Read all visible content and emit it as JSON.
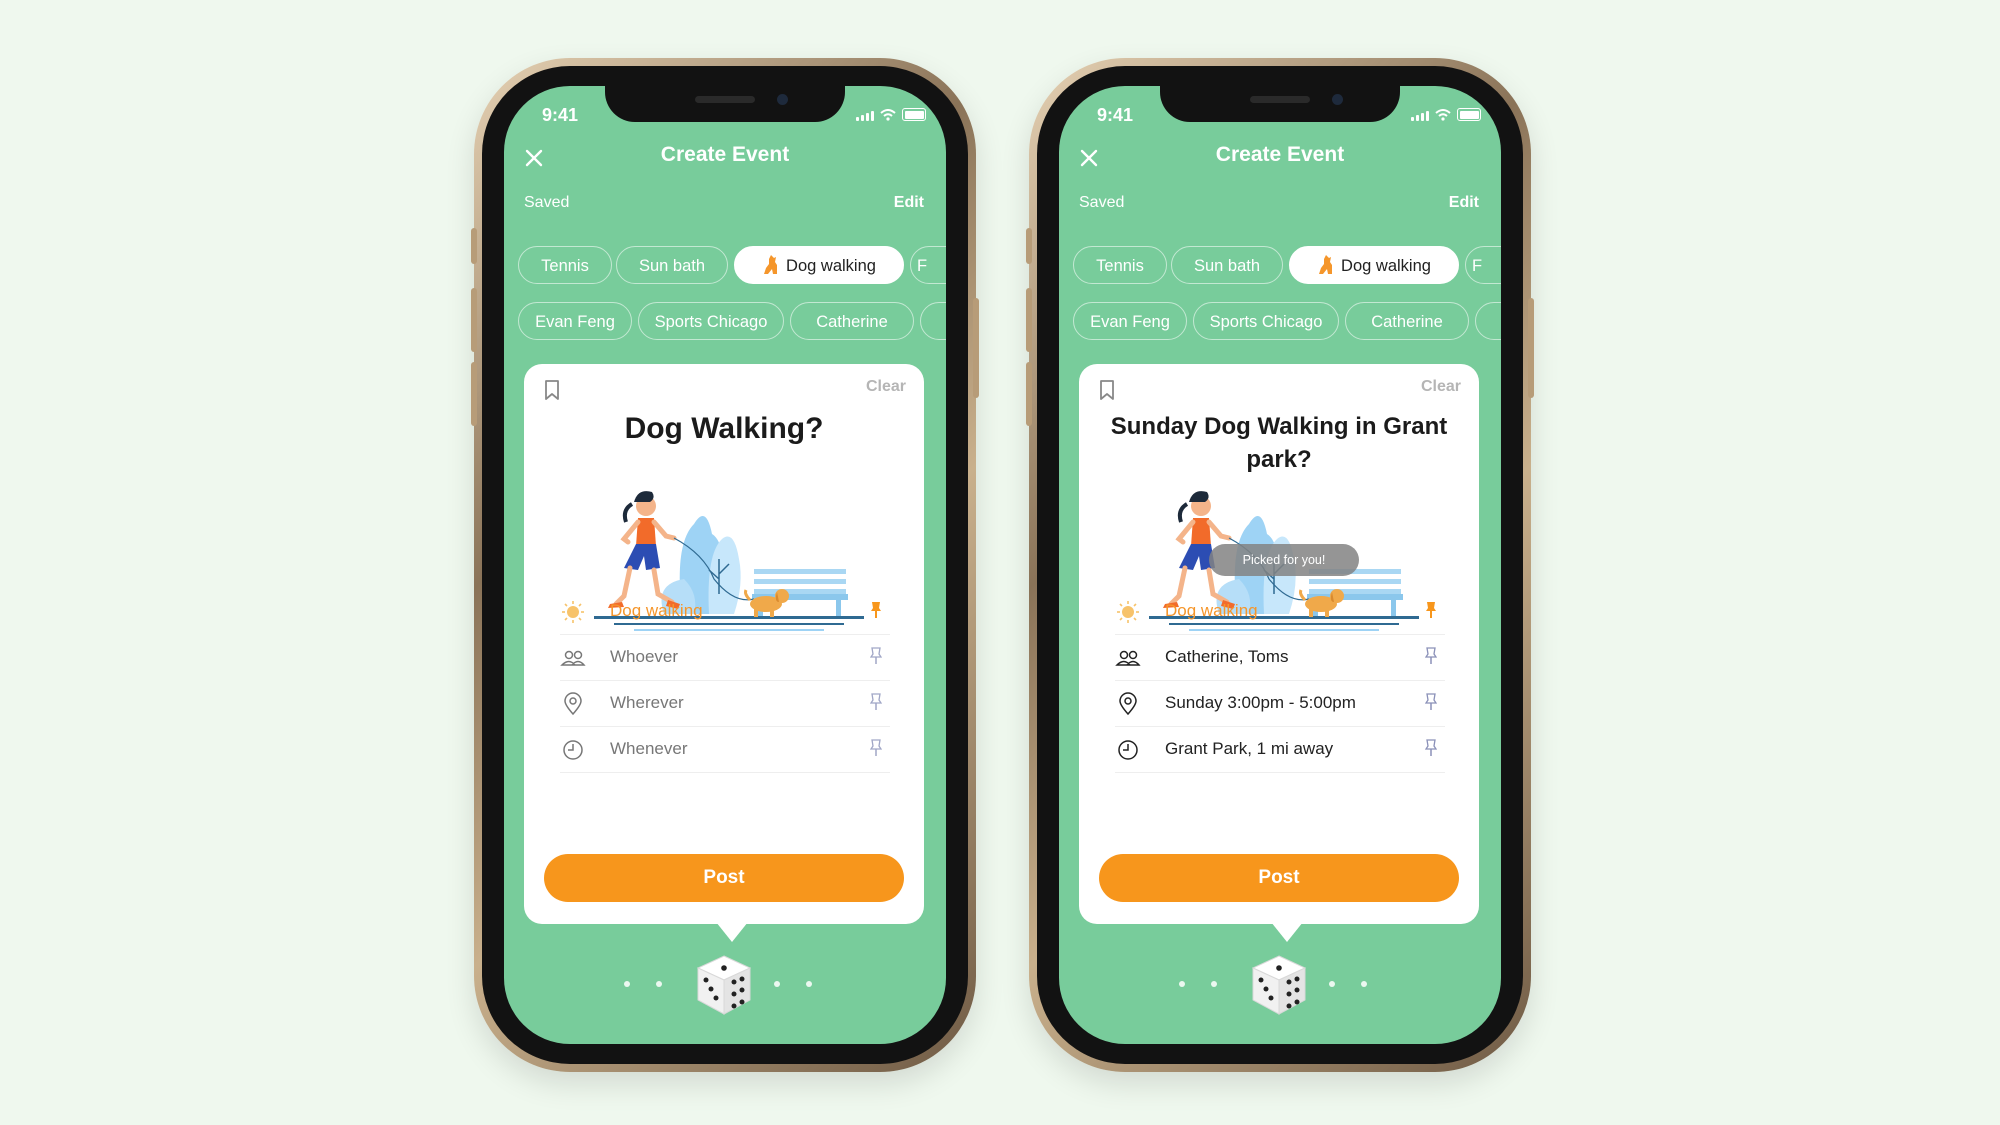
{
  "screens": [
    {
      "status_time": "9:41",
      "title": "Create Event",
      "saved_label": "Saved",
      "edit_label": "Edit",
      "chips_row1": [
        "Tennis",
        "Sun bath",
        "Dog walking",
        "F"
      ],
      "chips_row2": [
        "Evan Feng",
        "Sports Chicago",
        "Catherine",
        ""
      ],
      "active_chip": "Dog walking",
      "clear_label": "Clear",
      "card_title": "Dog Walking?",
      "tooltip": "",
      "rows": [
        {
          "icon": "sun-icon",
          "label": "Dog walking",
          "pinned": true
        },
        {
          "icon": "people-icon",
          "label": "Whoever",
          "pinned": false
        },
        {
          "icon": "location-pin-icon",
          "label": "Wherever",
          "pinned": false
        },
        {
          "icon": "clock-icon",
          "label": "Whenever",
          "pinned": false
        }
      ],
      "post_label": "Post"
    },
    {
      "status_time": "9:41",
      "title": "Create Event",
      "saved_label": "Saved",
      "edit_label": "Edit",
      "chips_row1": [
        "Tennis",
        "Sun bath",
        "Dog walking",
        "F"
      ],
      "chips_row2": [
        "Evan Feng",
        "Sports Chicago",
        "Catherine",
        ""
      ],
      "active_chip": "Dog walking",
      "clear_label": "Clear",
      "card_title": "Sunday Dog Walking in Grant park?",
      "tooltip": "Picked for you!",
      "rows": [
        {
          "icon": "sun-icon",
          "label": "Dog walking",
          "pinned": true
        },
        {
          "icon": "people-icon",
          "label": "Catherine, Toms",
          "pinned": false
        },
        {
          "icon": "location-pin-icon",
          "label": "Sunday 3:00pm - 5:00pm",
          "pinned": false
        },
        {
          "icon": "clock-icon",
          "label": "Grant Park, 1 mi away",
          "pinned": false
        }
      ],
      "post_label": "Post"
    }
  ],
  "colors": {
    "background": "#eff8ee",
    "screen_green": "#78cc9b",
    "accent_orange": "#f7961c",
    "activity_text": "#f5962b"
  }
}
